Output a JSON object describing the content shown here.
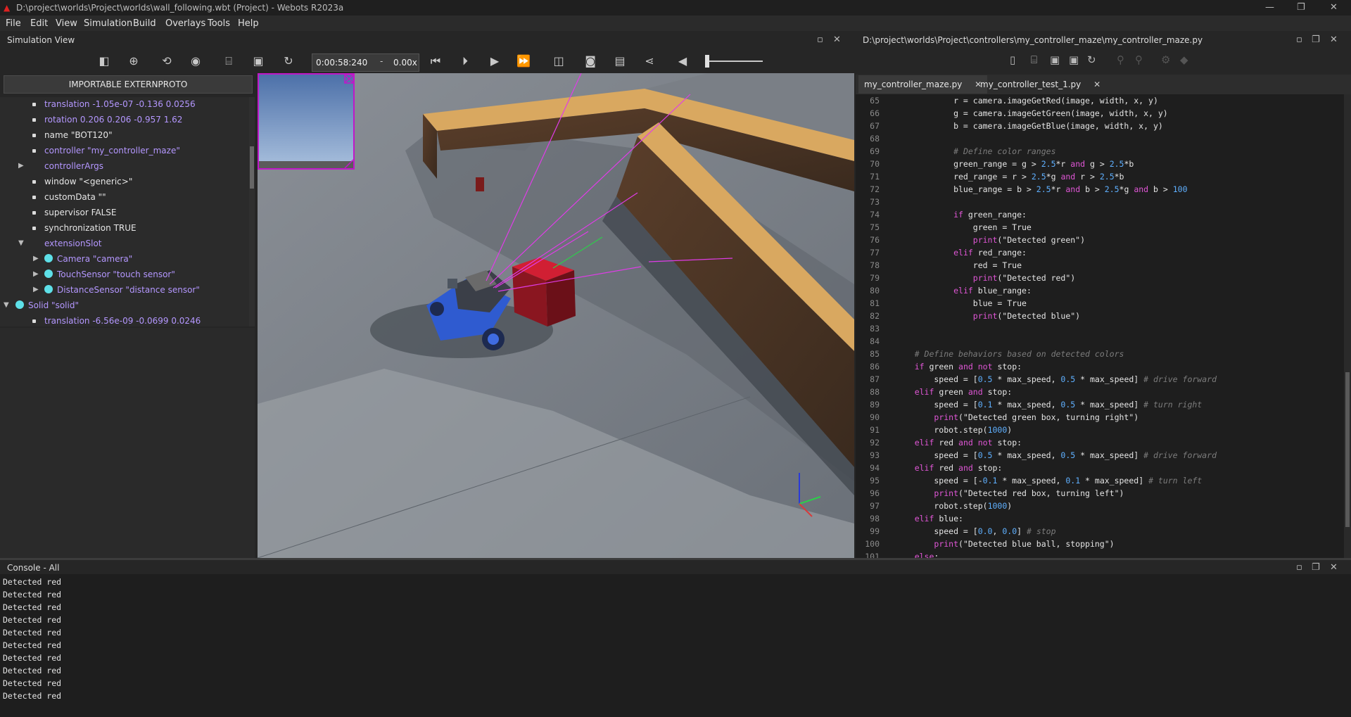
{
  "window": {
    "title": "D:\\project\\worlds\\Project\\worlds\\wall_following.wbt (Project) - Webots R2023a",
    "controls": [
      "—",
      "❐",
      "✕"
    ]
  },
  "menu": [
    "File",
    "Edit",
    "View",
    "Simulation",
    "Build",
    "Overlays",
    "Tools",
    "Help"
  ],
  "sim_view": {
    "title": "Simulation View",
    "time": "0:00:58:240",
    "speed": "0.00x",
    "time_sep": "-"
  },
  "scene_tree": {
    "proto_button": "IMPORTABLE EXTERNPROTO",
    "nodes": [
      {
        "text": "translation -1.05e-07 -0.136 0.0256",
        "style": "purple"
      },
      {
        "text": "rotation 0.206 0.206 -0.957 1.62",
        "style": "purple"
      },
      {
        "text": "name \"BOT120\"",
        "style": "white"
      },
      {
        "text": "controller \"my_controller_maze\"",
        "style": "purple"
      },
      {
        "text": "controllerArgs",
        "style": "purple"
      },
      {
        "text": "window \"<generic>\"",
        "style": "white"
      },
      {
        "text": "customData \"\"",
        "style": "white"
      },
      {
        "text": "supervisor FALSE",
        "style": "white"
      },
      {
        "text": "synchronization TRUE",
        "style": "white"
      },
      {
        "text": "extensionSlot",
        "style": "purple"
      },
      {
        "text": "Camera \"camera\"",
        "style": "purple"
      },
      {
        "text": "TouchSensor \"touch sensor\"",
        "style": "purple"
      },
      {
        "text": "DistanceSensor \"distance sensor\"",
        "style": "purple"
      },
      {
        "text": "Solid \"solid\"",
        "style": "purple"
      },
      {
        "text": "translation -6.56e-09 -0.0699 0.0246",
        "style": "purple"
      }
    ]
  },
  "editor": {
    "path": "D:\\project\\worlds\\Project\\controllers\\my_controller_maze\\my_controller_maze.py",
    "tabs": [
      "my_controller_maze.py",
      "my_controller_test_1.py"
    ],
    "tab_close": "✕",
    "lines": [
      {
        "n": "65",
        "code": "            r = camera.imageGetRed(image, width, x, y)"
      },
      {
        "n": "66",
        "code": "            g = camera.imageGetGreen(image, width, x, y)"
      },
      {
        "n": "67",
        "code": "            b = camera.imageGetBlue(image, width, x, y)"
      },
      {
        "n": "68",
        "code": ""
      },
      {
        "n": "69",
        "code": "            # Define color ranges"
      },
      {
        "n": "70",
        "code": "            green_range = g > 2.5*r and g > 2.5*b"
      },
      {
        "n": "71",
        "code": "            red_range = r > 2.5*g and r > 2.5*b"
      },
      {
        "n": "72",
        "code": "            blue_range = b > 2.5*r and b > 2.5*g and b > 100"
      },
      {
        "n": "73",
        "code": ""
      },
      {
        "n": "74",
        "code": "            if green_range:"
      },
      {
        "n": "75",
        "code": "                green = True"
      },
      {
        "n": "76",
        "code": "                print(\"Detected green\")"
      },
      {
        "n": "77",
        "code": "            elif red_range:"
      },
      {
        "n": "78",
        "code": "                red = True"
      },
      {
        "n": "79",
        "code": "                print(\"Detected red\")"
      },
      {
        "n": "80",
        "code": "            elif blue_range:"
      },
      {
        "n": "81",
        "code": "                blue = True"
      },
      {
        "n": "82",
        "code": "                print(\"Detected blue\")"
      },
      {
        "n": "83",
        "code": ""
      },
      {
        "n": "84",
        "code": ""
      },
      {
        "n": "85",
        "code": "    # Define behaviors based on detected colors"
      },
      {
        "n": "86",
        "code": "    if green and not stop:"
      },
      {
        "n": "87",
        "code": "        speed = [0.5 * max_speed, 0.5 * max_speed] # drive forward"
      },
      {
        "n": "88",
        "code": "    elif green and stop:"
      },
      {
        "n": "89",
        "code": "        speed = [0.1 * max_speed, 0.5 * max_speed] # turn right"
      },
      {
        "n": "90",
        "code": "        print(\"Detected green box, turning right\")"
      },
      {
        "n": "91",
        "code": "        robot.step(1000)"
      },
      {
        "n": "92",
        "code": "    elif red and not stop:"
      },
      {
        "n": "93",
        "code": "        speed = [0.5 * max_speed, 0.5 * max_speed] # drive forward"
      },
      {
        "n": "94",
        "code": "    elif red and stop:"
      },
      {
        "n": "95",
        "code": "        speed = [-0.1 * max_speed, 0.1 * max_speed] # turn left"
      },
      {
        "n": "96",
        "code": "        print(\"Detected red box, turning left\")"
      },
      {
        "n": "97",
        "code": "        robot.step(1000)"
      },
      {
        "n": "98",
        "code": "    elif blue:"
      },
      {
        "n": "99",
        "code": "        speed = [0.0, 0.0] # stop"
      },
      {
        "n": "100",
        "code": "        print(\"Detected blue ball, stopping\")"
      },
      {
        "n": "101",
        "code": "    else:"
      }
    ]
  },
  "console": {
    "title": "Console - All",
    "lines": [
      "Detected red",
      "Detected red",
      "Detected red",
      "Detected red",
      "Detected red",
      "Detected red",
      "Detected red",
      "Detected red",
      "Detected red",
      "Detected red"
    ]
  },
  "colors": {
    "accent_purple": "#b497ff",
    "keyword": "#e056d6",
    "number": "#5fb0ff",
    "comment": "#7c7c7c",
    "sensor_ball": "#5ee0e8"
  }
}
